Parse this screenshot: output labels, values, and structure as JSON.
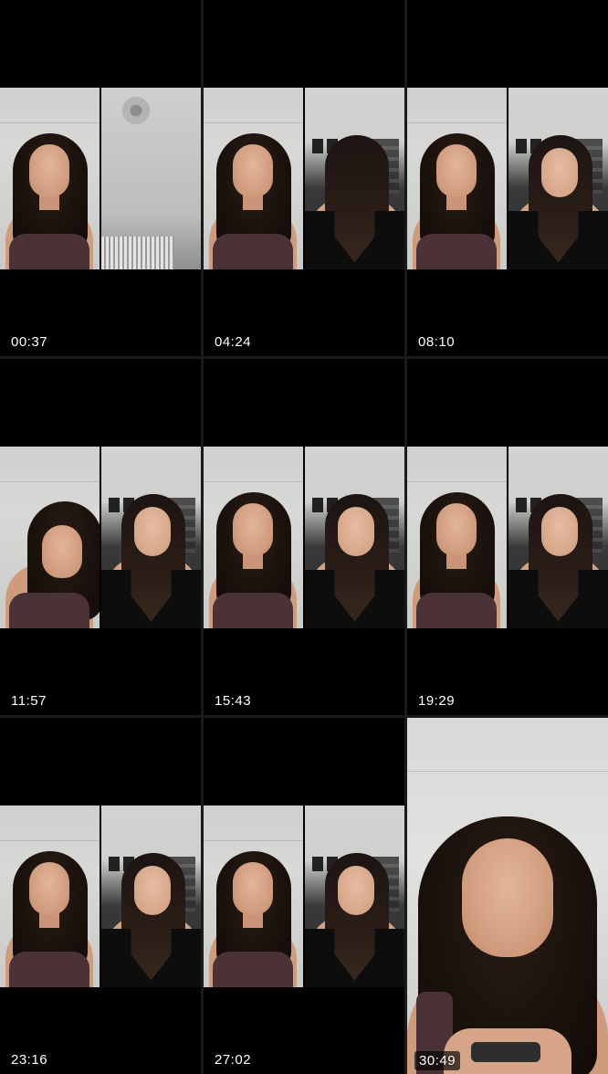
{
  "grid": {
    "tiles": [
      {
        "timestamp": "00:37"
      },
      {
        "timestamp": "04:24"
      },
      {
        "timestamp": "08:10"
      },
      {
        "timestamp": "11:57"
      },
      {
        "timestamp": "15:43"
      },
      {
        "timestamp": "19:29"
      },
      {
        "timestamp": "23:16"
      },
      {
        "timestamp": "27:02"
      },
      {
        "timestamp": "30:49"
      }
    ]
  },
  "colors": {
    "background": "#000000",
    "divider": "#1a1a1a",
    "timestamp_text": "#ffffff"
  }
}
